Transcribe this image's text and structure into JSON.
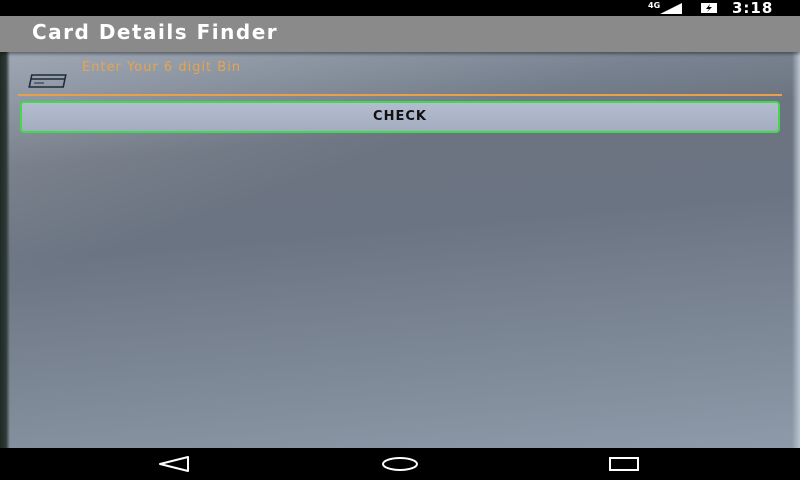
{
  "status_bar": {
    "network": "4G",
    "time": "3:18",
    "icons": [
      "signal-icon",
      "battery-icon"
    ]
  },
  "app_bar": {
    "title": "Card Details Finder"
  },
  "form": {
    "bin_placeholder": "Enter Your 6 digit Bin",
    "bin_value": "",
    "card_icon": "credit-card-icon",
    "check_label": "CHECK"
  },
  "nav_bar": {
    "buttons": [
      "back-icon",
      "home-icon",
      "recents-icon"
    ]
  },
  "colors": {
    "accent": "#e8a04a",
    "button_border": "#3fdb4b",
    "app_bar": "#8a8a8a"
  }
}
